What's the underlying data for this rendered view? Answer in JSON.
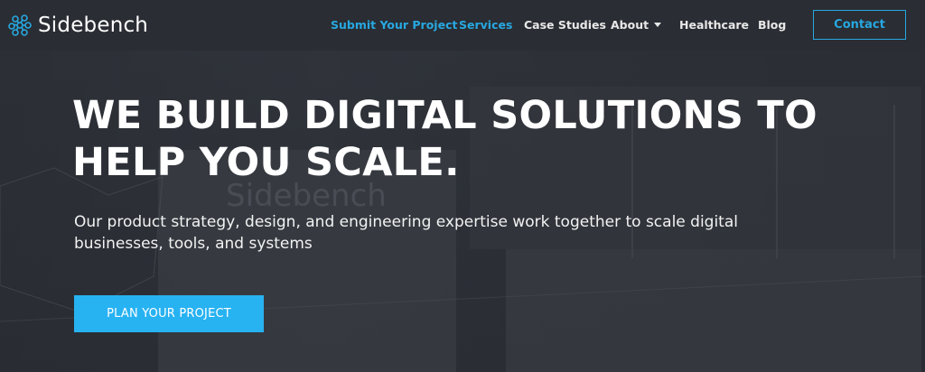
{
  "header": {
    "logo": {
      "name": "Sidebench",
      "icon": "brain-network-icon"
    },
    "nav": [
      {
        "label": "Submit Your Project",
        "accent": true
      },
      {
        "label": "Services",
        "accent": true
      },
      {
        "label": "Case Studies",
        "accent": false
      },
      {
        "label": "About",
        "accent": false,
        "has_dropdown": true
      },
      {
        "label": "Healthcare",
        "accent": false
      },
      {
        "label": "Blog",
        "accent": false
      }
    ],
    "contact_label": "Contact"
  },
  "hero": {
    "title": "WE BUILD DIGITAL SOLUTIONS TO HELP YOU SCALE.",
    "subtitle": "Our product strategy, design, and engineering expertise work together to scale digital businesses, tools, and systems",
    "cta_label": "PLAN YOUR PROJECT",
    "background_text": "Sidebench"
  },
  "colors": {
    "accent": "#27a8e0",
    "cta": "#27b2f2",
    "header_bg": "#2a2d33"
  }
}
